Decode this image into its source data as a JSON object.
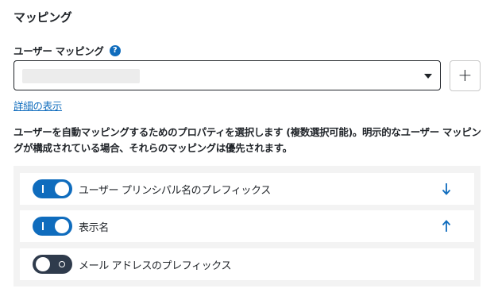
{
  "section": {
    "title": "マッピング"
  },
  "field": {
    "label": "ユーザー マッピング",
    "help_glyph": "?",
    "select_value": "",
    "add_glyph": "+",
    "details_link": "詳細の表示"
  },
  "description": "ユーザーを自動マッピングするためのプロパティを選択します (複数選択可能)。明示的なユーザー マッピングが構成されている場合、それらのマッピングは優先されます。",
  "items": [
    {
      "label": "ユーザー プリンシパル名のプレフィックス",
      "enabled": true,
      "arrow": "down-arrow-icon"
    },
    {
      "label": "表示名",
      "enabled": true,
      "arrow": "up-arrow-icon"
    },
    {
      "label": "メール アドレスのプレフィックス",
      "enabled": false,
      "arrow": null
    }
  ],
  "colors": {
    "accent": "#0f6cbd",
    "toggle_off": "#2f3b4c",
    "panel_bg": "#f3f3f3"
  }
}
